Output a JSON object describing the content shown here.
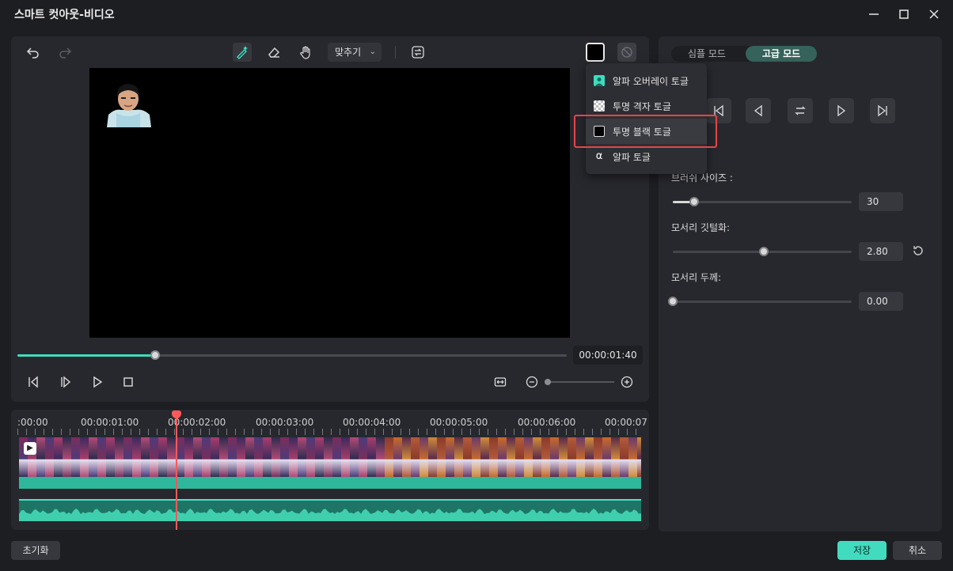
{
  "window": {
    "title": "스마트 컷아웃-비디오"
  },
  "toolbar": {
    "fit_label": "맞추기"
  },
  "menu": {
    "items": [
      {
        "label": "알파 오버레이 토글",
        "icon": "alpha-overlay-icon"
      },
      {
        "label": "투명 격자 토글",
        "icon": "checkerboard-icon"
      },
      {
        "label": "투명 블랙 토글",
        "icon": "black-square-icon",
        "highlighted": true
      },
      {
        "label": "알파 토글",
        "icon": "alpha-icon",
        "glyph": "α"
      }
    ]
  },
  "player": {
    "timecode": "00:00:01:40",
    "progress": 0.25
  },
  "timeline": {
    "ruler": [
      ":00:00",
      "00:00:01:00",
      "00:00:02:00",
      "00:00:03:00",
      "00:00:04:00",
      "00:00:05:00",
      "00:00:06:00",
      "00:00:07"
    ],
    "playhead_time": "00:00:02:00"
  },
  "settings": {
    "modes": {
      "simple": "심플 모드",
      "advanced": "고급 모드"
    },
    "brush_size": {
      "label": "브러쉬 사이즈 :",
      "value": "30",
      "level": 0.12
    },
    "edge_feather": {
      "label": "모서리 깃털화:",
      "value": "2.80",
      "level": 0.51
    },
    "edge_thickness": {
      "label": "모서리 두께:",
      "value": "0.00",
      "level": 0.0
    }
  },
  "footer": {
    "reset_label": "초기화",
    "save_label": "저장",
    "cancel_label": "취소"
  },
  "colors": {
    "accent": "#41dcbf",
    "highlight_box": "#e54548",
    "panel": "#27282d"
  }
}
